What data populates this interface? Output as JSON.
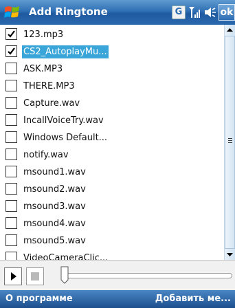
{
  "titlebar": {
    "title": "Add Ringtone",
    "network_indicator": "G",
    "ok_label": "ok"
  },
  "files": [
    {
      "name": "123.mp3",
      "checked": true,
      "selected": false
    },
    {
      "name": "CS2_AutoplayMu...",
      "checked": true,
      "selected": true
    },
    {
      "name": "ASK.MP3",
      "checked": false,
      "selected": false
    },
    {
      "name": "THERE.MP3",
      "checked": false,
      "selected": false
    },
    {
      "name": "Capture.wav",
      "checked": false,
      "selected": false
    },
    {
      "name": "IncallVoiceTry.wav",
      "checked": false,
      "selected": false
    },
    {
      "name": "Windows Default...",
      "checked": false,
      "selected": false
    },
    {
      "name": "notify.wav",
      "checked": false,
      "selected": false
    },
    {
      "name": "msound1.wav",
      "checked": false,
      "selected": false
    },
    {
      "name": "msound2.wav",
      "checked": false,
      "selected": false
    },
    {
      "name": "msound3.wav",
      "checked": false,
      "selected": false
    },
    {
      "name": "msound4.wav",
      "checked": false,
      "selected": false
    },
    {
      "name": "msound5.wav",
      "checked": false,
      "selected": false
    },
    {
      "name": "VideoCameraClic...",
      "checked": false,
      "selected": false
    }
  ],
  "player": {
    "position_fraction": 0.0
  },
  "softkeys": {
    "left": "О программе",
    "right": "Добавить ме..."
  },
  "colors": {
    "titlebar": "#2f6fb4",
    "selection": "#3aa5d8",
    "softbar": "#1d4f8d"
  }
}
